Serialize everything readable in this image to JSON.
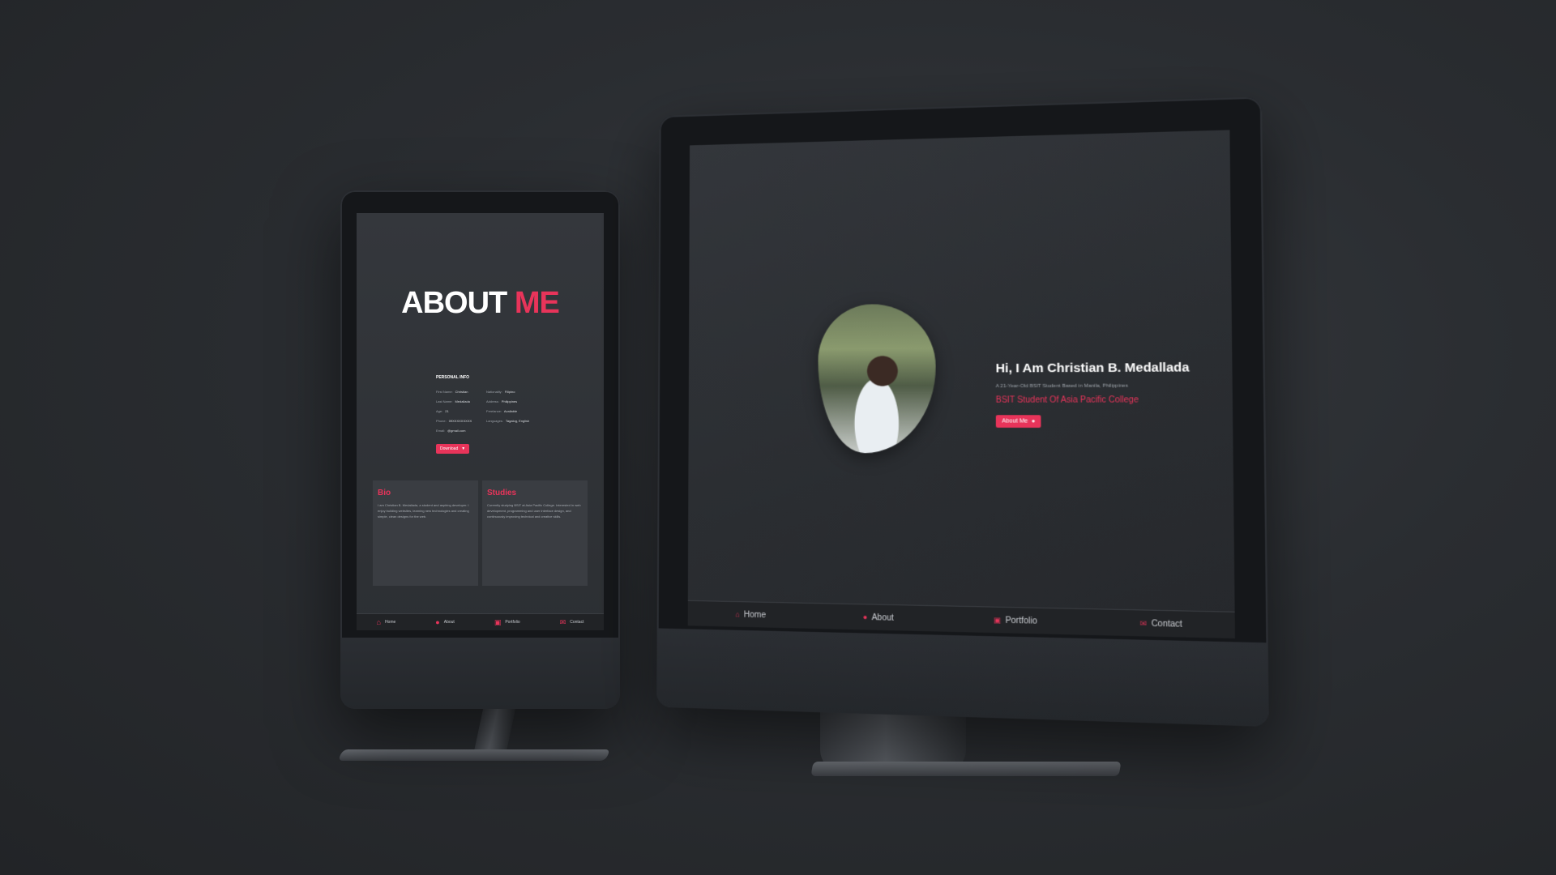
{
  "left_site": {
    "heading_main": "ABOUT",
    "heading_accent": "ME",
    "personal_info_title": "PERSONAL INFO",
    "info_left": [
      {
        "k": "First Name:",
        "v": "Christian"
      },
      {
        "k": "Last Name:",
        "v": "Medallada"
      },
      {
        "k": "Age:",
        "v": "21"
      },
      {
        "k": "Phone:",
        "v": "09XXXXXXXXX"
      },
      {
        "k": "Email:",
        "v": "@gmail.com"
      }
    ],
    "info_right": [
      {
        "k": "Nationality:",
        "v": "Filipino"
      },
      {
        "k": "Address:",
        "v": "Philippines"
      },
      {
        "k": "Freelance:",
        "v": "Available"
      },
      {
        "k": "Languages:",
        "v": "Tagalog, English"
      }
    ],
    "download_label": "Download",
    "bio_title": "Bio",
    "bio_text": "I am Christian B. Medallada, a student and aspiring developer. I enjoy building websites, learning new technologies and creating simple, clean designs for the web.",
    "studies_title": "Studies",
    "studies_text": "Currently studying BSIT at Asia Pacific College. Interested in web development, programming and user interface design, and continuously improving technical and creative skills.",
    "nav": [
      {
        "icon": "⌂",
        "label": "Home"
      },
      {
        "icon": "●",
        "label": "About"
      },
      {
        "icon": "▣",
        "label": "Portfolio"
      },
      {
        "icon": "✉",
        "label": "Contact"
      }
    ]
  },
  "right_site": {
    "greeting": "Hi, I Am Christian B. Medallada",
    "subtitle": "A 21-Year-Old BSIT Student Based in Manila, Philippines",
    "role": "BSIT Student Of Asia Pacific College",
    "about_button_label": "About Me",
    "nav": [
      {
        "icon": "⌂",
        "label": "Home"
      },
      {
        "icon": "●",
        "label": "About"
      },
      {
        "icon": "▣",
        "label": "Portfolio"
      },
      {
        "icon": "✉",
        "label": "Contact"
      }
    ]
  },
  "icons": {
    "apple": ""
  },
  "colors": {
    "accent": "#e8345a",
    "background": "#2a2d31",
    "screen": "#2b2e33"
  }
}
